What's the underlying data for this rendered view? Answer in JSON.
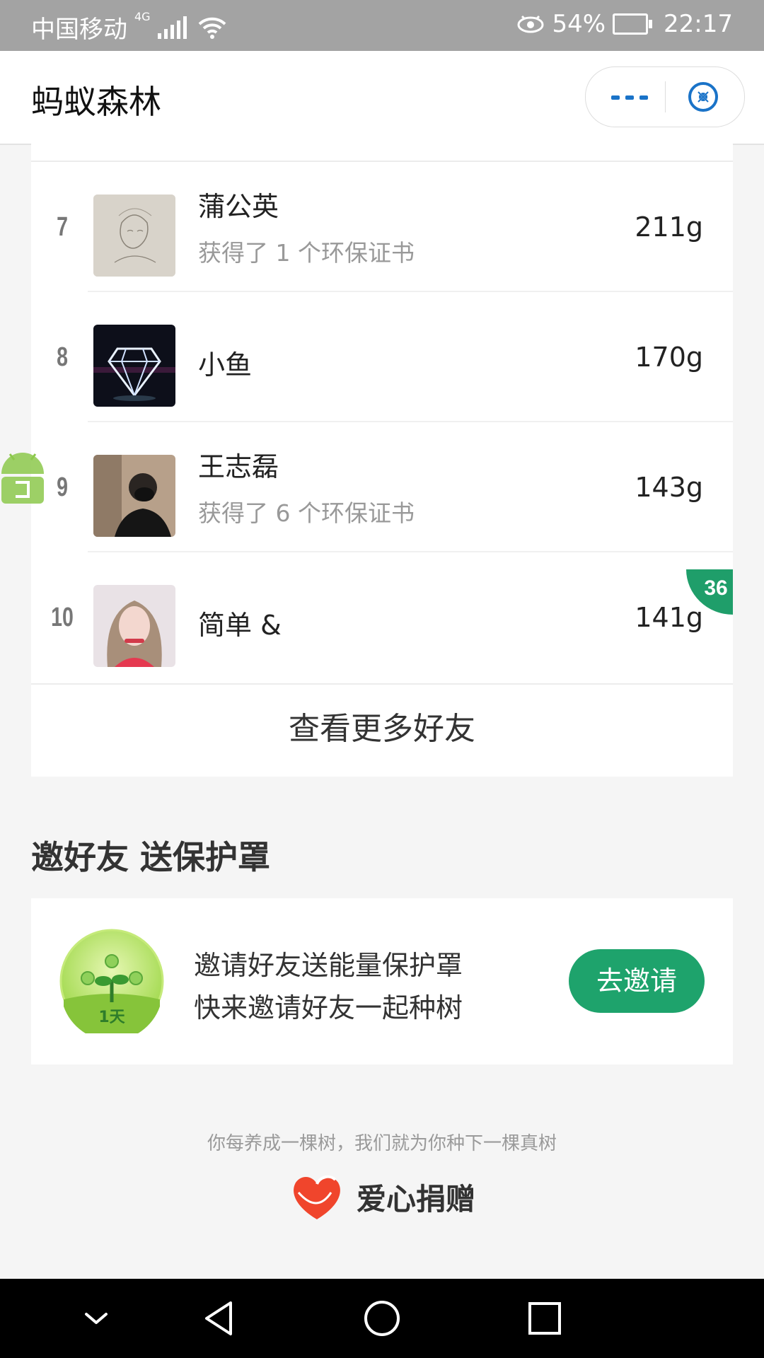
{
  "status_bar": {
    "carrier": "中国移动",
    "network": "4G",
    "battery": "54%",
    "time": "22:17"
  },
  "header": {
    "title": "蚂蚁森林"
  },
  "ranking": [
    {
      "rank": "7",
      "name": "蒲公英",
      "sub": "获得了 1 个环保证书",
      "energy": "211g"
    },
    {
      "rank": "8",
      "name": "小鱼",
      "sub": "",
      "energy": "170g"
    },
    {
      "rank": "9",
      "name": "王志磊",
      "sub": "获得了 6 个环保证书",
      "energy": "143g"
    },
    {
      "rank": "10",
      "name": "简单 &",
      "sub": "",
      "energy": "141g"
    }
  ],
  "badge_value": "36",
  "more_friends_label": "查看更多好友",
  "invite": {
    "section_title": "邀好友 送保护罩",
    "line1": "邀请好友送能量保护罩",
    "line2": "快来邀请好友一起种树",
    "icon_label": "1天",
    "button_label": "去邀请"
  },
  "footer": {
    "note": "你每养成一棵树，我们就为你种下一棵真树",
    "donation_label": "爱心捐赠"
  },
  "colors": {
    "accent_green": "#1ea36c",
    "capsule_blue": "#1a73c8",
    "status_bar_gray": "#a3a3a3"
  }
}
